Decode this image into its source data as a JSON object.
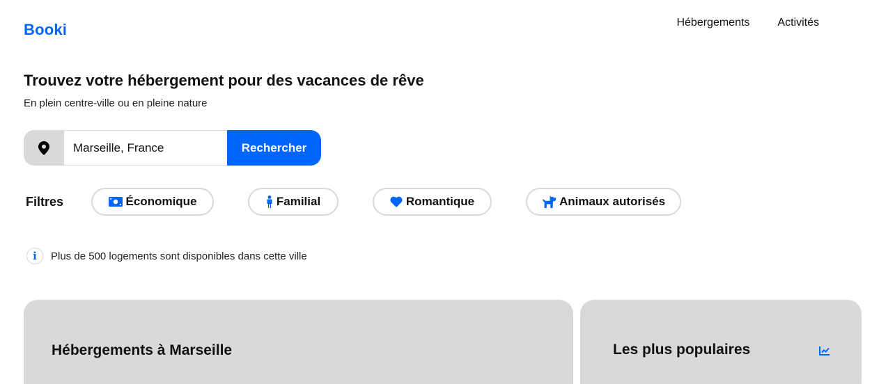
{
  "header": {
    "logo": "Booki",
    "nav": [
      "Hébergements",
      "Activités"
    ]
  },
  "hero": {
    "title": "Trouvez votre hébergement pour des vacances de rêve",
    "subtitle": "En plein centre-ville ou en pleine nature"
  },
  "search": {
    "icon": "map-pin-icon",
    "value": "Marseille, France",
    "button_label": "Rechercher"
  },
  "filters": {
    "label": "Filtres",
    "items": [
      {
        "label": "Économique",
        "icon": "money-bill-icon"
      },
      {
        "label": "Familial",
        "icon": "child-icon"
      },
      {
        "label": "Romantique",
        "icon": "heart-icon"
      },
      {
        "label": "Animaux autorisés",
        "icon": "dog-icon"
      }
    ]
  },
  "info": {
    "icon": "info-icon",
    "text": "Plus de 500 logements sont disponibles dans cette ville"
  },
  "sections": {
    "lodgings_title": "Hébergements à Marseille",
    "popular_title": "Les plus populaires",
    "popular_icon": "chart-line-icon"
  },
  "colors": {
    "accent": "#0065fc",
    "card_bg": "#d9d9d9",
    "chip_border": "#d9d9d9"
  }
}
